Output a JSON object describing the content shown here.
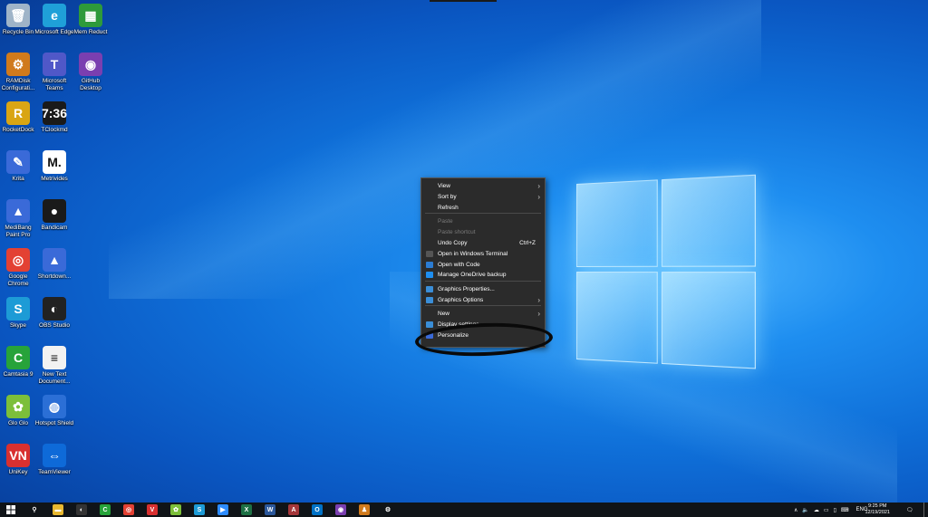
{
  "desktop_icons": [
    {
      "label": "Recycle Bin",
      "icon": "recycle-bin-icon",
      "color": "#9fb4c8",
      "glyph": "🗑"
    },
    {
      "label": "Microsoft Edge",
      "icon": "edge-icon",
      "color": "#1fa0d8",
      "glyph": "e"
    },
    {
      "label": "Mem Reduct",
      "icon": "mem-reduct-icon",
      "color": "#2e9a3a",
      "glyph": "▦"
    },
    {
      "label": "RAMDisk Configurati...",
      "icon": "ramdisk-icon",
      "color": "#d07a1c",
      "glyph": "⚙"
    },
    {
      "label": "Microsoft Teams",
      "icon": "teams-icon",
      "color": "#5058c8",
      "glyph": "T"
    },
    {
      "label": "GitHub Desktop",
      "icon": "github-desktop-icon",
      "color": "#7a3fb0",
      "glyph": "◉"
    },
    {
      "label": "RocketDock",
      "icon": "rocketdock-icon",
      "color": "#d9a514",
      "glyph": "R"
    },
    {
      "label": "TClockmd",
      "icon": "tclock-icon",
      "color": "#1a1a1a",
      "glyph": "7:36"
    },
    {
      "label": "Krita",
      "icon": "krita-icon",
      "color": "#3a6ad8",
      "glyph": "✎"
    },
    {
      "label": "Metrivides",
      "icon": "metrivides-icon",
      "color": "#ffffff",
      "glyph": "M."
    },
    {
      "label": "MediBang Paint Pro",
      "icon": "medibang-icon",
      "color": "#3a6ad8",
      "glyph": "▲"
    },
    {
      "label": "Bandicam",
      "icon": "bandicam-icon",
      "color": "#1a1a1a",
      "glyph": "●"
    },
    {
      "label": "Google Chrome",
      "icon": "chrome-icon",
      "color": "#e34133",
      "glyph": "◎"
    },
    {
      "label": "Shortdown...",
      "icon": "shortdown-icon",
      "color": "#3a6ad8",
      "glyph": "▲"
    },
    {
      "label": "Skype",
      "icon": "skype-icon",
      "color": "#1d9bd6",
      "glyph": "S"
    },
    {
      "label": "OBS Studio",
      "icon": "obs-icon",
      "color": "#222222",
      "glyph": "◐"
    },
    {
      "label": "Camtasia 9",
      "icon": "camtasia-icon",
      "color": "#27a33a",
      "glyph": "C"
    },
    {
      "label": "New Text Document...",
      "icon": "text-document-icon",
      "color": "#f2f2f2",
      "glyph": "≡"
    },
    {
      "label": "Glo Glo",
      "icon": "glo-icon",
      "color": "#7cbf3a",
      "glyph": "✿"
    },
    {
      "label": "Hotspot Shield",
      "icon": "hotspot-shield-icon",
      "color": "#2b6fd6",
      "glyph": "◍"
    },
    {
      "label": "UniKey",
      "icon": "unikey-icon",
      "color": "#d83030",
      "glyph": "VN"
    },
    {
      "label": "TeamViewer",
      "icon": "teamviewer-icon",
      "color": "#0e6ad8",
      "glyph": "⇔"
    }
  ],
  "context_menu": {
    "items": [
      {
        "label": "View",
        "submenu": true,
        "disabled": false,
        "shortcut": ""
      },
      {
        "label": "Sort by",
        "submenu": true,
        "disabled": false,
        "shortcut": ""
      },
      {
        "label": "Refresh",
        "submenu": false,
        "disabled": false,
        "shortcut": ""
      },
      {
        "label": "Paste",
        "submenu": false,
        "disabled": true,
        "shortcut": ""
      },
      {
        "label": "Paste shortcut",
        "submenu": false,
        "disabled": true,
        "shortcut": ""
      },
      {
        "label": "Undo Copy",
        "submenu": false,
        "disabled": false,
        "shortcut": "Ctrl+Z"
      },
      {
        "label": "Open in Windows Terminal",
        "submenu": false,
        "disabled": false,
        "shortcut": "",
        "icon": "terminal-icon"
      },
      {
        "label": "Open with Code",
        "submenu": false,
        "disabled": false,
        "shortcut": "",
        "icon": "vscode-icon"
      },
      {
        "label": "Manage OneDrive backup",
        "submenu": false,
        "disabled": false,
        "shortcut": "",
        "icon": "onedrive-icon"
      },
      {
        "label": "Graphics Properties...",
        "submenu": false,
        "disabled": false,
        "shortcut": "",
        "icon": "intel-graphics-icon"
      },
      {
        "label": "Graphics Options",
        "submenu": true,
        "disabled": false,
        "shortcut": "",
        "icon": "intel-graphics-icon"
      },
      {
        "label": "New",
        "submenu": true,
        "disabled": false,
        "shortcut": ""
      },
      {
        "label": "Display settings",
        "submenu": false,
        "disabled": false,
        "shortcut": "",
        "icon": "display-icon"
      },
      {
        "label": "Personalize",
        "submenu": false,
        "disabled": false,
        "shortcut": "",
        "icon": "personalize-icon"
      }
    ],
    "submenu_arrow": "›"
  },
  "taskbar": {
    "start_icon": "windows-start-icon",
    "pinned": [
      {
        "icon": "search-icon",
        "color": "#101418",
        "glyph": "⚲"
      },
      {
        "icon": "file-explorer-icon",
        "color": "#e8b830",
        "glyph": "▬"
      },
      {
        "icon": "obs-icon",
        "color": "#333333",
        "glyph": "◐"
      },
      {
        "icon": "camtasia-icon",
        "color": "#27a33a",
        "glyph": "C"
      },
      {
        "icon": "chrome-icon",
        "color": "#e34133",
        "glyph": "◎"
      },
      {
        "icon": "unikey-icon",
        "color": "#d83030",
        "glyph": "V"
      },
      {
        "icon": "glo-icon",
        "color": "#7cbf3a",
        "glyph": "✿"
      },
      {
        "icon": "skype-icon",
        "color": "#1d9bd6",
        "glyph": "S"
      },
      {
        "icon": "zoom-icon",
        "color": "#2d8cff",
        "glyph": "▶"
      },
      {
        "icon": "excel-icon",
        "color": "#1e7145",
        "glyph": "X"
      },
      {
        "icon": "word-icon",
        "color": "#2b579a",
        "glyph": "W"
      },
      {
        "icon": "access-icon",
        "color": "#a4373a",
        "glyph": "A"
      },
      {
        "icon": "outlook-icon",
        "color": "#0072c6",
        "glyph": "O"
      },
      {
        "icon": "github-desktop-icon",
        "color": "#7a3fb0",
        "glyph": "◉"
      },
      {
        "icon": "app-icon",
        "color": "#d07a1c",
        "glyph": "♟"
      },
      {
        "icon": "settings-gear-icon",
        "color": "#101418",
        "glyph": "⚙"
      }
    ],
    "tray": {
      "language": "ENG",
      "time": "9:25 PM",
      "date": "12/19/2021"
    }
  }
}
